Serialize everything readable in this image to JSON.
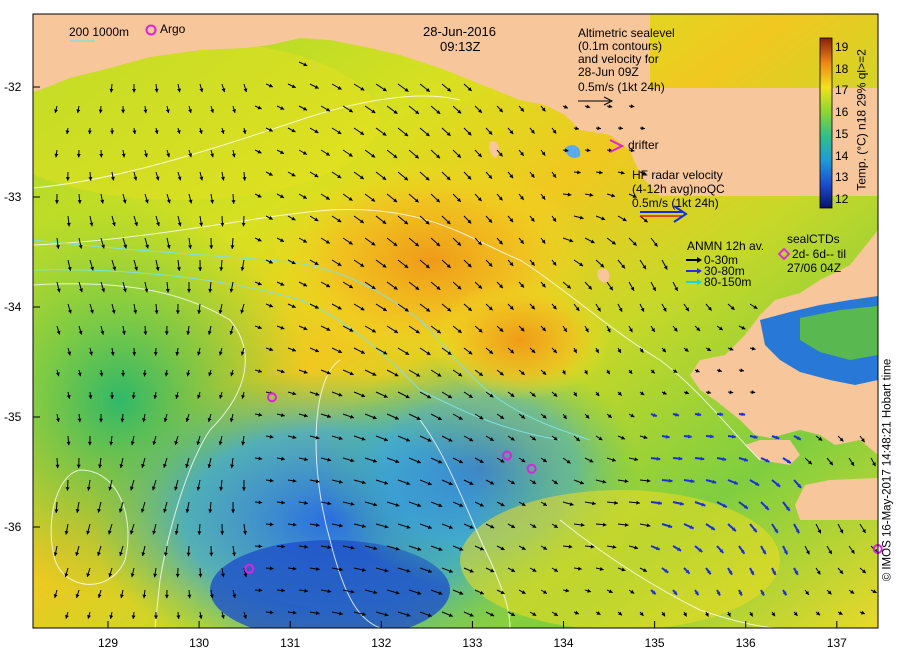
{
  "header": {
    "date": "28-Jun-2016",
    "time": "09:13Z",
    "argo_label": "Argo",
    "isobath_label": "200 1000m"
  },
  "legend": {
    "altimetric": [
      "Altimetric sealevel",
      "(0.1m contours)",
      "and velocity for",
      "28-Jun 09Z",
      "0.5m/s (1kt 24h)"
    ],
    "drifter": "drifter",
    "hf_radar": [
      "HF radar velocity",
      "(4-12h avg)noQC",
      "0.5m/s (1kt 24h)"
    ],
    "anmn": [
      "ANMN 12h av.",
      "0-30m",
      "30-80m",
      "80-150m"
    ],
    "sealctds": [
      "sealCTDs",
      "2d- 6d-- til",
      "27/06 04Z"
    ]
  },
  "colorbar": {
    "label": "Temp. (°C) n18 29% ql>=2",
    "ticks": [
      12,
      13,
      14,
      15,
      16,
      17,
      18,
      19
    ]
  },
  "axes": {
    "lat_ticks": [
      "-32",
      "-33",
      "-34",
      "-35",
      "-36"
    ],
    "lon_ticks": [
      "129",
      "130",
      "131",
      "132",
      "133",
      "134",
      "135",
      "136",
      "137"
    ]
  },
  "credit": "© IMOS 16-May-2017 14:48:21 Hobart time",
  "argo_floats": [
    [
      130.8,
      -34.82
    ],
    [
      133.38,
      -35.35
    ],
    [
      133.65,
      -35.47
    ],
    [
      130.55,
      -36.38
    ],
    [
      137.45,
      -36.2
    ]
  ],
  "colors": {
    "land": "#f7c69a",
    "argo": "#e020e0",
    "drifter": "#e020e0",
    "hf_radar": "#1030e0",
    "anmn_0_30": "#000000",
    "anmn_30_80": "#2030e0",
    "anmn_80_150": "#20d0e0",
    "isobath": "#7fe0e0"
  }
}
